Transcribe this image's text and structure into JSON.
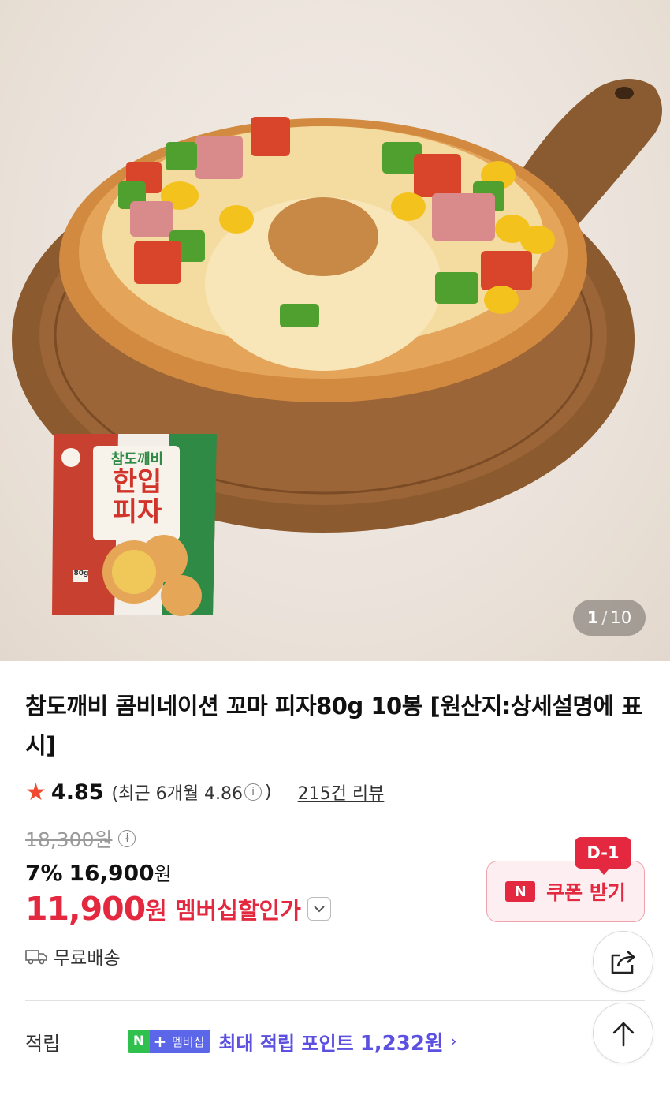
{
  "gallery": {
    "current": "1",
    "separator": "/",
    "total": "10",
    "package": {
      "brand": "참도깨비",
      "name_line1": "한입",
      "name_line2": "피자",
      "weight": "80g"
    }
  },
  "product": {
    "title": "참도깨비 콤비네이션 꼬마 피자80g 10봉 [원산지:상세설명에 표시]"
  },
  "rating": {
    "score": "4.85",
    "recent_prefix": "(최근 6개월 4.86",
    "recent_suffix": ")",
    "reviews": "215건 리뷰"
  },
  "price": {
    "original": "18,300원",
    "discount_rate": "7%",
    "discounted": "16,900",
    "won": "원",
    "member_price": "11,900",
    "member_won": "원",
    "member_label": "멤버십할인가"
  },
  "coupon": {
    "dday": "D-1",
    "badge": "N",
    "label": "쿠폰 받기"
  },
  "shipping": {
    "label": "무료배송"
  },
  "points": {
    "label": "적립",
    "badge_n": "N",
    "badge_plus": "+",
    "badge_text": "멤버십",
    "max_label": "최대 적립 포인트",
    "amount": "1,232원",
    "chevron": "›"
  },
  "colors": {
    "accent_red": "#e3283f",
    "star": "#f04a33",
    "membership_purple": "#5b50e0",
    "naver_green": "#2fc04d"
  }
}
